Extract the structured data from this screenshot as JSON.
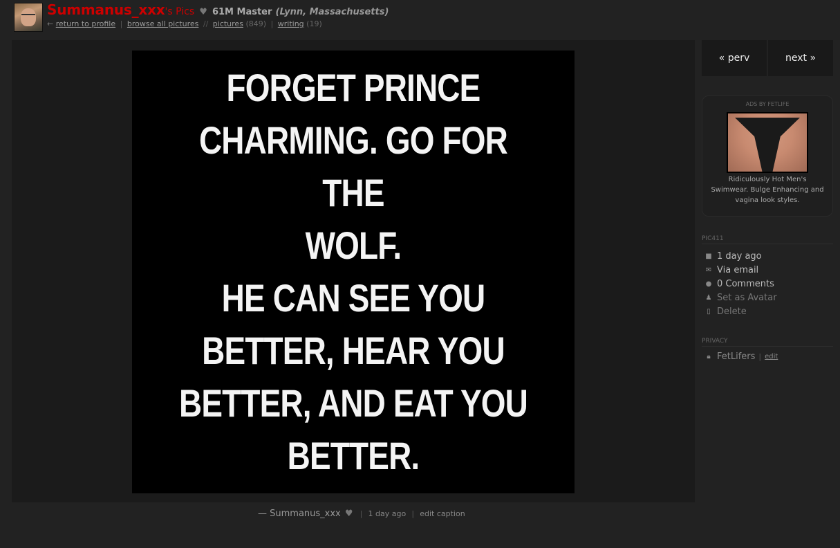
{
  "header": {
    "username": "Summanus_xxx",
    "pics_suffix": "'s Pics",
    "user_meta": "61M Master",
    "location": "(Lynn, Massachusetts)",
    "back_arrow": "←",
    "return_link": "return to profile",
    "browse_link": "browse all pictures",
    "slashes": "//",
    "pictures_link": "pictures",
    "pictures_count": "(849)",
    "writing_link": "writing",
    "writing_count": "(19)"
  },
  "picture": {
    "text": "FORGET PRINCE\nCHARMING. GO FOR THE\nWOLF.\nHE CAN SEE YOU\nBETTER, HEAR YOU\nBETTER, AND EAT YOU\nBETTER."
  },
  "caption": {
    "author": "— Summanus_xxx",
    "time": "1 day ago",
    "edit": "edit caption"
  },
  "nav": {
    "prev": "« perv",
    "next": "next »"
  },
  "ad": {
    "header": "ADS BY FETLIFE",
    "text": "Ridiculously Hot Men's Swimwear. Bulge Enhancing and vagina look styles."
  },
  "meta": {
    "section": "PIC411",
    "items": [
      {
        "icon": "camera-icon",
        "label": "1 day ago"
      },
      {
        "icon": "envelope-icon",
        "label": "Via email"
      },
      {
        "icon": "comment-icon",
        "label": "0 Comments"
      },
      {
        "icon": "user-icon",
        "label": "Set as Avatar"
      },
      {
        "icon": "trash-icon",
        "label": "Delete"
      }
    ]
  },
  "privacy": {
    "section": "PRIVACY",
    "value": "FetLifers",
    "edit": "edit"
  }
}
